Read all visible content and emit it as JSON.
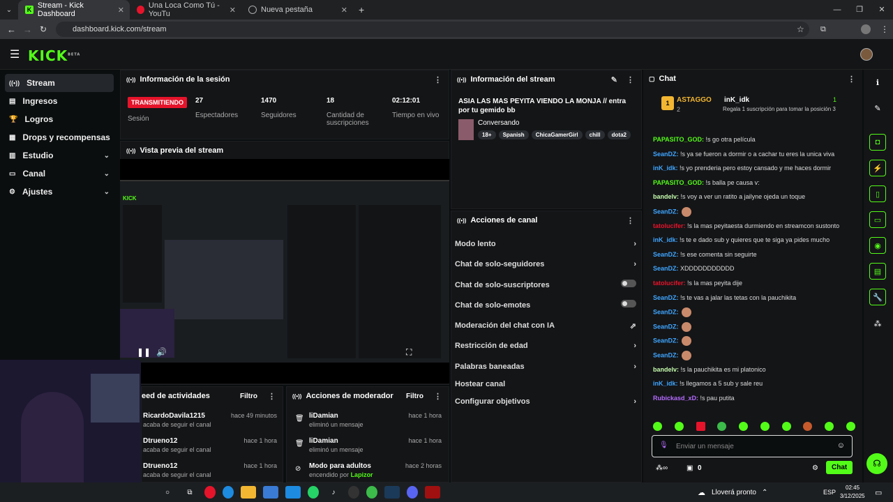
{
  "browser": {
    "tabs": [
      {
        "label": "Stream - Kick Dashboard",
        "active": true
      },
      {
        "label": "Una Loca Como Tú - YouTu",
        "active": false
      },
      {
        "label": "Nueva pestaña",
        "active": false
      }
    ],
    "url": "dashboard.kick.com/stream"
  },
  "brand": {
    "logo": "KICK",
    "beta": "BETA",
    "accent": "#53fc18"
  },
  "sidebar": {
    "items": [
      {
        "label": "Stream",
        "icon": "broadcast-icon",
        "active": true
      },
      {
        "label": "Ingresos",
        "icon": "income-icon"
      },
      {
        "label": "Logros",
        "icon": "trophy-icon"
      },
      {
        "label": "Drops y recompensas",
        "icon": "gift-icon"
      },
      {
        "label": "Estudio",
        "icon": "studio-icon",
        "expandable": true
      },
      {
        "label": "Canal",
        "icon": "channel-icon",
        "expandable": true
      },
      {
        "label": "Ajustes",
        "icon": "gear-icon",
        "expandable": true
      }
    ]
  },
  "session": {
    "title": "Información de la sesión",
    "live_badge": "TRANSMITIENDO",
    "session_label": "Sesión",
    "stats": [
      {
        "value": "27",
        "label": "Espectadores"
      },
      {
        "value": "1470",
        "label": "Seguidores"
      },
      {
        "value": "18",
        "label": "Cantidad de suscripciones"
      },
      {
        "value": "02:12:01",
        "label": "Tiempo en vivo"
      }
    ]
  },
  "preview": {
    "title": "Vista previa del stream"
  },
  "stream_info": {
    "title": "Información del stream",
    "stream_title": "ASIA LAS MAS PEYITA VIENDO LA MONJA // entra por tu gemido bb",
    "category": "Conversando",
    "tags": [
      "18+",
      "Spanish",
      "ChicaGamerGirl",
      "chill",
      "dota2"
    ]
  },
  "channel_actions": {
    "title": "Acciones de canal",
    "items": [
      {
        "label": "Modo lento",
        "control": "arrow"
      },
      {
        "label": "Chat de solo-seguidores",
        "control": "arrow"
      },
      {
        "label": "Chat de solo-suscriptores",
        "control": "toggle"
      },
      {
        "label": "Chat de solo-emotes",
        "control": "toggle"
      },
      {
        "label": "Moderación del chat con IA",
        "control": "external"
      },
      {
        "label": "Restricción de edad",
        "control": "arrow"
      },
      {
        "label": "Palabras baneadas",
        "control": "arrow"
      },
      {
        "label": "Hostear canal",
        "control": "none"
      },
      {
        "label": "Configurar objetivos",
        "control": "arrow"
      }
    ]
  },
  "activity": {
    "title": "eed de actividades",
    "filter": "Filtro",
    "items": [
      {
        "user": "RicardoDavila1215",
        "text": "acaba de seguir el canal",
        "time": "hace 49 minutos"
      },
      {
        "user": "Dtrueno12",
        "text": "acaba de seguir el canal",
        "time": "hace 1 hora"
      },
      {
        "user": "Dtrueno12",
        "text": "acaba de seguir el canal",
        "time": "hace 1 hora"
      }
    ]
  },
  "mod_actions": {
    "title": "Acciones de moderador",
    "filter": "Filtro",
    "items": [
      {
        "user": "liDamian",
        "text": "eliminó un mensaje",
        "time": "hace 1 hora"
      },
      {
        "user": "liDamian",
        "text": "eliminó un mensaje",
        "time": "hace 1 hora"
      },
      {
        "user": "Modo para adultos",
        "text": "encendido por",
        "by": "Lapizor",
        "time": "hace 2 horas"
      }
    ]
  },
  "chat": {
    "title": "Chat",
    "top_user": "ASTAGGO",
    "top_user_count": "2",
    "top_user2": "inK_idk",
    "top_user2_count": "1",
    "gift_text": "Regala 1 suscripción para tomar la posición 3",
    "messages": [
      {
        "user": "PAPASITO_GOD:",
        "text": "!s go otra película",
        "color": "#53fc18"
      },
      {
        "user": "SeanDZ:",
        "text": "!s ya se fueron a dormir o a cachar tu eres la unica viva",
        "color": "#3fa6ff"
      },
      {
        "user": "inK_idk:",
        "text": "!s yo prenderia pero estoy cansado y me haces dormir",
        "color": "#3fa6ff"
      },
      {
        "user": "PAPASITO_GOD:",
        "text": "!s balla pe causa v:",
        "color": "#53fc18"
      },
      {
        "user": "bandelv:",
        "text": "!s voy a ver un ratito a jailyne ojeda un toque",
        "color": "#c8ffb0"
      },
      {
        "user": "SeanDZ:",
        "text": "",
        "color": "#3fa6ff"
      },
      {
        "user": "tatolucifer:",
        "text": "!s la mas peyitaesta durmiendo en streamcon sustonto",
        "color": "#e5142b"
      },
      {
        "user": "inK_idk:",
        "text": "!s te e dado sub y quieres que te siga ya pides mucho",
        "color": "#3fa6ff"
      },
      {
        "user": "SeanDZ:",
        "text": "!s ese comenta sin seguirte",
        "color": "#3fa6ff"
      },
      {
        "user": "SeanDZ:",
        "text": "XDDDDDDDDDDD",
        "color": "#3fa6ff"
      },
      {
        "user": "tatolucifer:",
        "text": "!s la mas peyita dije",
        "color": "#e5142b"
      },
      {
        "user": "SeanDZ:",
        "text": "!s te vas a jalar las tetas con la pauchikita",
        "color": "#3fa6ff"
      },
      {
        "user": "SeanDZ:",
        "text": "",
        "color": "#3fa6ff"
      },
      {
        "user": "SeanDZ:",
        "text": "",
        "color": "#3fa6ff"
      },
      {
        "user": "SeanDZ:",
        "text": "",
        "color": "#3fa6ff"
      },
      {
        "user": "SeanDZ:",
        "text": "",
        "color": "#3fa6ff"
      },
      {
        "user": "bandelv:",
        "text": "!s la pauchikita es mi platonico",
        "color": "#c8ffb0"
      },
      {
        "user": "inK_idk:",
        "text": "!s llegamos a 5 sub y sale reu",
        "color": "#3fa6ff"
      },
      {
        "user": "Rubickasd_xD:",
        "text": "!s pau putita",
        "color": "#b46bff"
      }
    ],
    "input_placeholder": "Enviar un mensaje",
    "points": "0",
    "send_label": "Chat"
  },
  "taskbar": {
    "weather": "Lloverá pronto",
    "lang": "ESP",
    "time": "02:45",
    "date": "3/12/2025"
  }
}
